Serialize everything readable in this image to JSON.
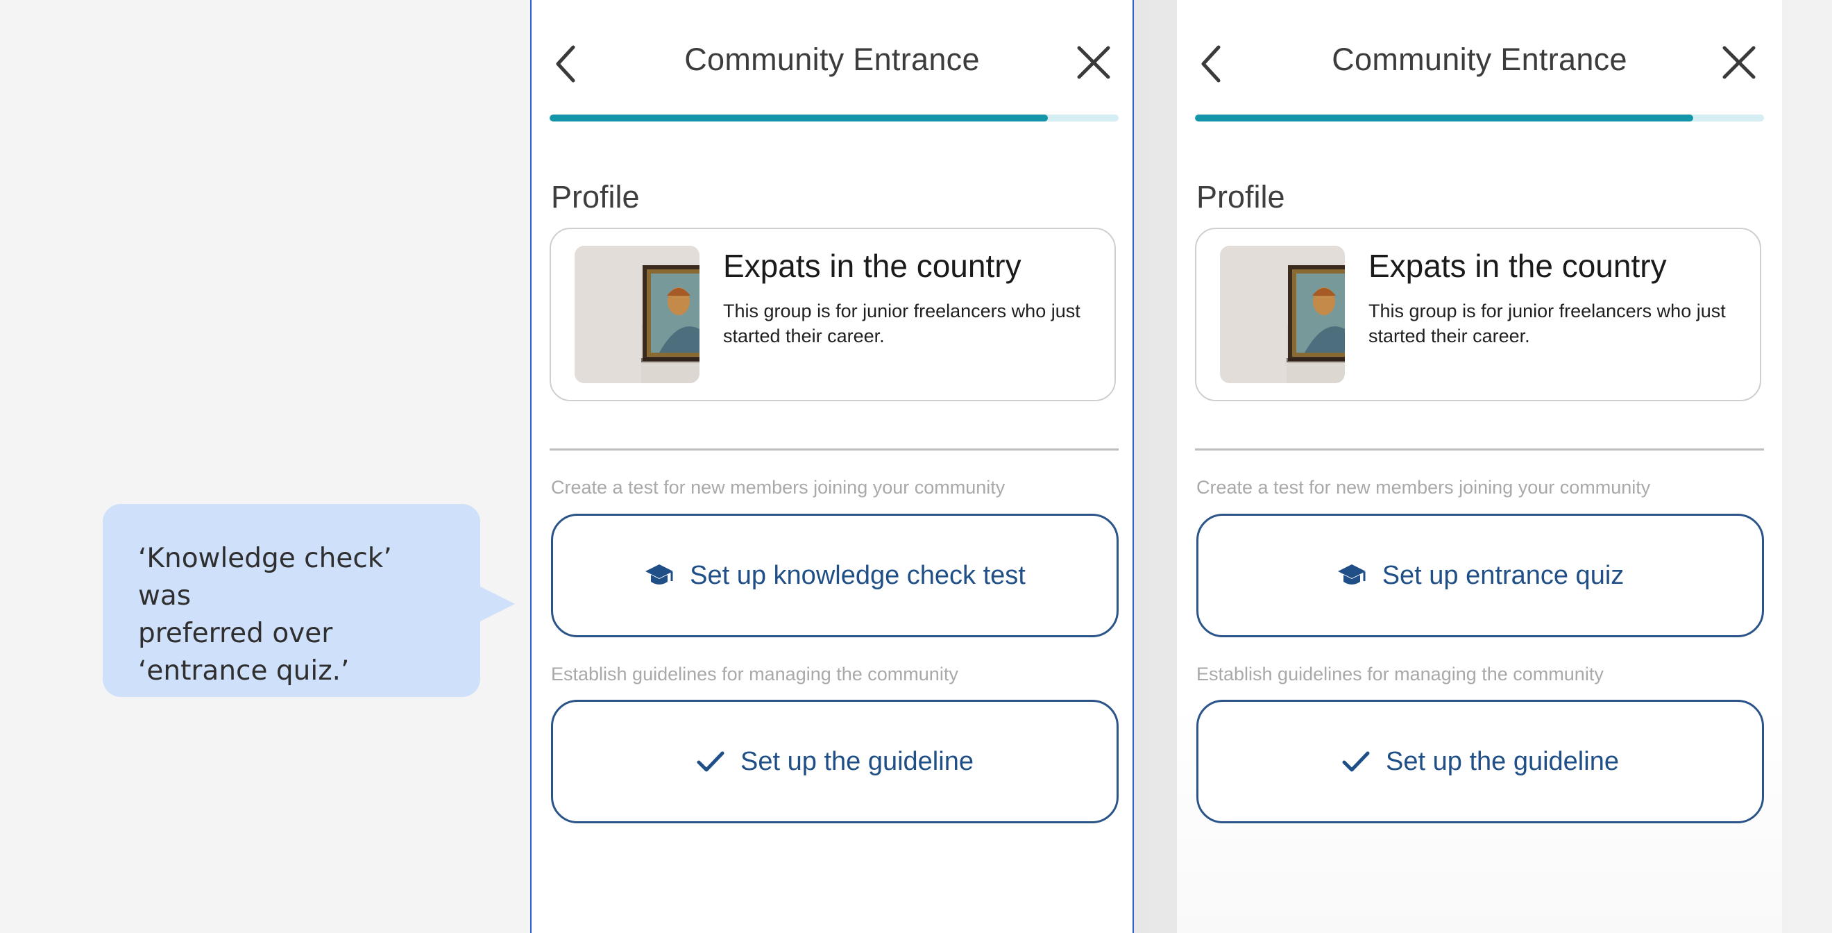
{
  "callout": {
    "text": "‘Knowledge check’ was\npreferred over\n‘entrance quiz.’",
    "color": "#cfe0fb"
  },
  "screens": [
    {
      "header": {
        "title": "Community Entrance",
        "back_icon": "chevron-left-icon",
        "close_icon": "close-icon"
      },
      "progress": 0.875,
      "profile": {
        "section_title": "Profile",
        "name": "Expats in the country",
        "description": "This group is for junior freelancers who just started their career."
      },
      "test": {
        "hint": "Create a test for new members joining your community",
        "button_label": "Set up knowledge check test",
        "button_icon": "graduation-cap-icon"
      },
      "guideline": {
        "hint": "Establish guidelines for managing the community",
        "button_label": "Set up the guideline",
        "button_icon": "checkmark-icon"
      }
    },
    {
      "header": {
        "title": "Community Entrance",
        "back_icon": "chevron-left-icon",
        "close_icon": "close-icon"
      },
      "progress": 0.875,
      "profile": {
        "section_title": "Profile",
        "name": "Expats in the country",
        "description": "This group is for junior freelancers who just started their career."
      },
      "test": {
        "hint": "Create a test for new members joining your community",
        "button_label": "Set up entrance quiz",
        "button_icon": "graduation-cap-icon"
      },
      "guideline": {
        "hint": "Establish guidelines for managing the community",
        "button_label": "Set up the guideline",
        "button_icon": "checkmark-icon"
      }
    }
  ],
  "colors": {
    "accent": "#1496a9",
    "progress_track": "#d4eef3",
    "button_text": "#1f4f86",
    "button_border": "#2b5588",
    "selection": "#2f5fd0"
  }
}
